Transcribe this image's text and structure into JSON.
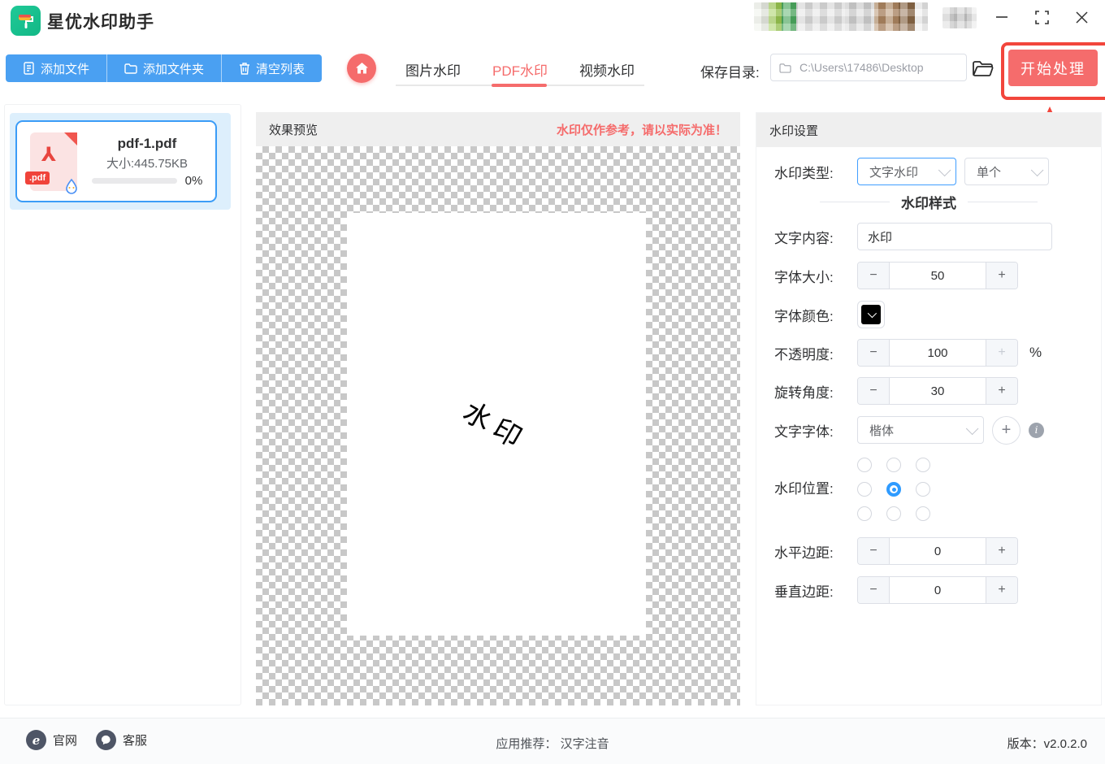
{
  "app": {
    "title": "星优水印助手"
  },
  "toolbar": {
    "add_file": "添加文件",
    "add_folder": "添加文件夹",
    "clear_list": "清空列表"
  },
  "tabs": [
    {
      "label": "图片水印",
      "active": false
    },
    {
      "label": "PDF水印",
      "active": true
    },
    {
      "label": "视频水印",
      "active": false
    }
  ],
  "save": {
    "label": "保存目录:",
    "path": "C:\\Users\\17486\\Desktop",
    "start_button": "开始处理"
  },
  "file": {
    "badge": ".pdf",
    "name": "pdf-1.pdf",
    "size_label": "大小:445.75KB",
    "progress": "0%"
  },
  "preview": {
    "title": "效果预览",
    "notice": "水印仅作参考，请以实际为准！",
    "watermark_text": "水印"
  },
  "settings": {
    "title": "水印设置",
    "type_label": "水印类型:",
    "type_value": "文字水印",
    "mode_value": "单个",
    "style_section": "水印样式",
    "text_label": "文字内容:",
    "text_value": "水印",
    "font_size_label": "字体大小:",
    "font_size_value": "50",
    "font_color_label": "字体颜色:",
    "opacity_label": "不透明度:",
    "opacity_value": "100",
    "opacity_unit": "%",
    "rotation_label": "旋转角度:",
    "rotation_value": "30",
    "font_label": "文字字体:",
    "font_value": "楷体",
    "position_label": "水印位置:",
    "position_selected_index": 4,
    "h_margin_label": "水平边距:",
    "h_margin_value": "0",
    "v_margin_label": "垂直边距:",
    "v_margin_value": "0",
    "stepper_minus": "−",
    "stepper_plus": "+"
  },
  "footer": {
    "website": "官网",
    "support": "客服",
    "recommend_label": "应用推荐：",
    "recommend_app": "汉字注音",
    "version": "版本：v2.0.2.0"
  },
  "colors": {
    "accent_blue": "#4aa0f2",
    "accent_red": "#f56c6c",
    "annotation_red": "#f2463c",
    "selected_border": "#3b9cf7"
  }
}
